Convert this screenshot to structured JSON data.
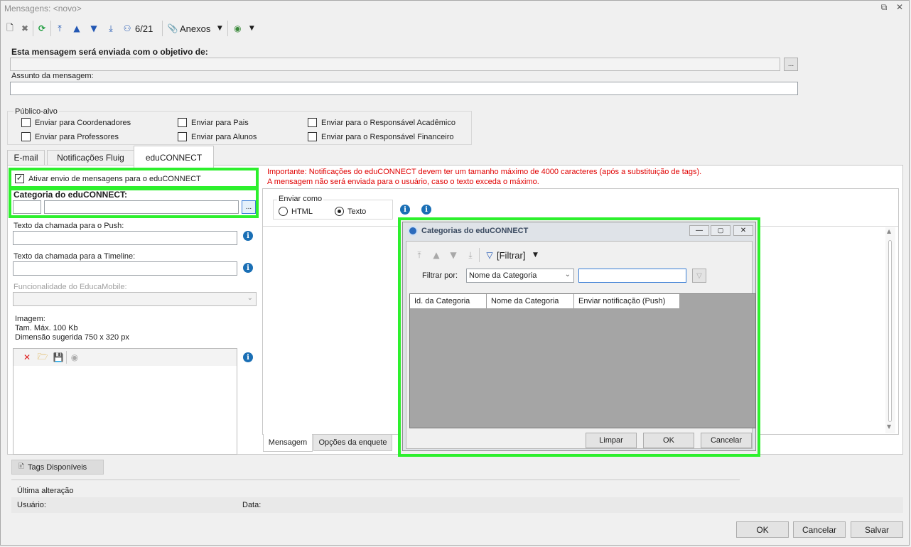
{
  "window": {
    "title": "Mensagens: <novo>"
  },
  "toolbar": {
    "record_counter": "6/21",
    "attachments_label": "Anexos"
  },
  "form": {
    "objective_label": "Esta mensagem será enviada com o objetivo de:",
    "objective_browse": "...",
    "subject_label": "Assunto da mensagem:",
    "audience": {
      "label": "Público-alvo",
      "options": [
        "Enviar para Coordenadores",
        "Enviar para Pais",
        "Enviar para o Responsável Acadêmico",
        "Enviar para Professores",
        "Enviar para Alunos",
        "Enviar para o Responsável Financeiro"
      ]
    }
  },
  "tabs": [
    "E-mail",
    "Notificações Fluig",
    "eduCONNECT"
  ],
  "educonnect": {
    "enable_label": "Ativar envio de mensagens para o eduCONNECT",
    "category_label": "Categoria do eduCONNECT:",
    "category_browse": "...",
    "push_label": "Texto da chamada para o Push:",
    "timeline_label": "Texto da chamada para a Timeline:",
    "feature_label": "Funcionalidade do EducaMobile:",
    "image_label": "Imagem:",
    "image_max": "Tam. Máx. 100 Kb",
    "image_dim": "Dimensão sugerida 750 x 320 px",
    "warning_line1": "Importante: Notificações do eduCONNECT devem ter um tamanho máximo de 4000 caracteres (após a substituição de tags).",
    "warning_line2": "A mensagem não será enviada para o usuário, caso o texto exceda o máximo.",
    "send_as_label": "Enviar como",
    "send_as_html": "HTML",
    "send_as_text": "Texto",
    "bottom_tabs": [
      "Mensagem",
      "Opções da enquete"
    ]
  },
  "dialog": {
    "title": "Categorias do eduCONNECT",
    "filter_button": "[Filtrar]",
    "filter_by_label": "Filtrar por:",
    "filter_by_value": "Nome da Categoria",
    "columns": [
      "Id. da Categoria",
      "Nome da Categoria",
      "Enviar notificação (Push)"
    ],
    "buttons": {
      "clear": "Limpar",
      "ok": "OK",
      "cancel": "Cancelar"
    }
  },
  "tags_button": "Tags Disponíveis",
  "last_change": {
    "label": "Última alteração",
    "user_label": "Usuário:",
    "date_label": "Data:"
  },
  "footer": {
    "ok": "OK",
    "cancel": "Cancelar",
    "save": "Salvar"
  },
  "colors": {
    "highlight": "#2df02d",
    "warning": "#e00000",
    "info": "#1a6fb5"
  }
}
